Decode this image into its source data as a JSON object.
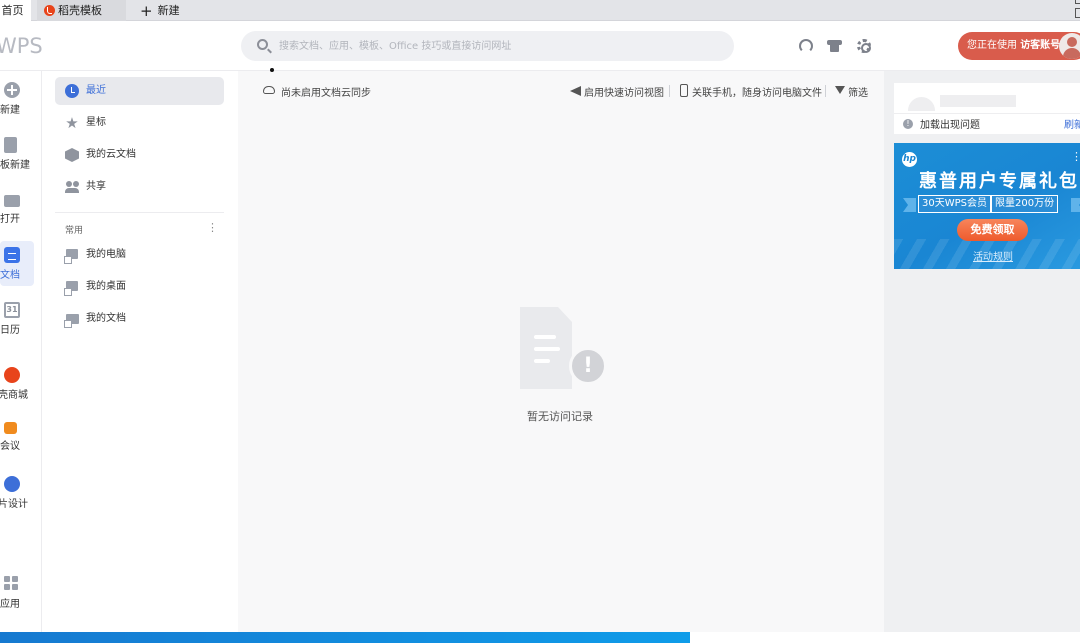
{
  "tabs": [
    {
      "label": "首页"
    },
    {
      "label": "稻壳模板"
    },
    {
      "label": "新建"
    }
  ],
  "header": {
    "logo": "WPS",
    "search_placeholder": "搜索文档、应用、模板、Office 技巧或直接访问网址",
    "icons": [
      "headset-icon",
      "shirt-icon",
      "gear-icon"
    ],
    "account_prefix": "您正在使用",
    "account_name": "访客账号"
  },
  "rail": {
    "items": [
      {
        "label": "新建",
        "icon": "plus-circle-icon"
      },
      {
        "label": "模板新建",
        "icon": "template-icon"
      },
      {
        "label": "打开",
        "icon": "folder-icon"
      },
      {
        "label": "文档",
        "icon": "document-icon",
        "active": true
      },
      {
        "label": "日历",
        "icon": "calendar-icon",
        "badge": "31"
      },
      {
        "label": "稻壳商城",
        "icon": "shop-icon"
      },
      {
        "label": "会议",
        "icon": "meeting-icon"
      },
      {
        "label": "图片设计",
        "icon": "design-icon"
      },
      {
        "label": "应用",
        "icon": "apps-icon"
      }
    ]
  },
  "nav": {
    "items": [
      {
        "label": "最近",
        "icon": "clock-icon",
        "active": true
      },
      {
        "label": "星标",
        "icon": "star-icon"
      },
      {
        "label": "我的云文档",
        "icon": "cloud-box-icon"
      },
      {
        "label": "共享",
        "icon": "people-icon"
      }
    ],
    "section_title": "常用",
    "section_more": "⋮",
    "common": [
      {
        "label": "我的电脑",
        "icon": "computer-icon"
      },
      {
        "label": "我的桌面",
        "icon": "desktop-icon"
      },
      {
        "label": "我的文档",
        "icon": "documents-folder-icon"
      }
    ]
  },
  "main": {
    "cloud_status": "尚未启用文档云同步",
    "quick_view": "启用快速访问视图",
    "link_phone": "关联手机，随身访问电脑文件",
    "filter": "筛选",
    "empty_text": "暂无访问记录"
  },
  "right": {
    "card_message": "加载出现问题",
    "refresh": "刷新",
    "ad": {
      "brand": "hp",
      "title": "惠普用户专属礼包",
      "ribbon_left": "30天WPS会员",
      "ribbon_right": "限量200万份",
      "button": "免费领取",
      "rules": "活动规则",
      "more": "⋮"
    }
  },
  "colors": {
    "accent": "#3d6fd8",
    "account_bg": "#d95c4c",
    "ad_bg": "#1a86d3",
    "ad_button": "#ee5a2c"
  }
}
